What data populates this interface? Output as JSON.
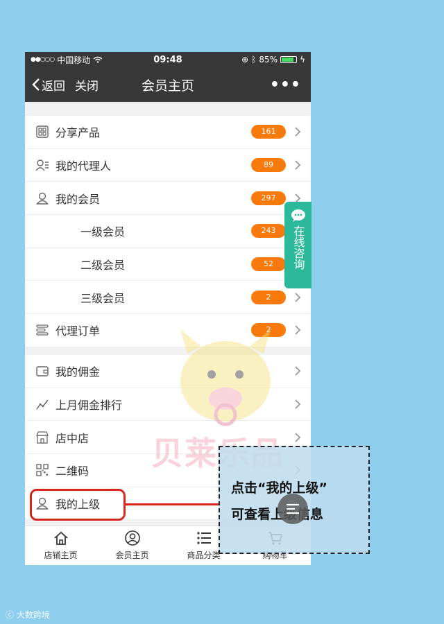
{
  "status_bar": {
    "carrier": "中国移动",
    "time": "09:48",
    "battery": "85%",
    "battery_level": 0.85
  },
  "nav": {
    "back_label": "返回",
    "close_label": "关闭",
    "title": "会员主页",
    "more_label": "•••"
  },
  "menu_group1": [
    {
      "icon": "grid-icon",
      "label": "分享产品",
      "count": "161",
      "sub": false
    },
    {
      "icon": "agent-icon",
      "label": "我的代理人",
      "count": "89",
      "sub": false
    },
    {
      "icon": "user-icon",
      "label": "我的会员",
      "count": "297",
      "sub": false
    },
    {
      "icon": "",
      "label": "一级会员",
      "count": "243",
      "sub": true
    },
    {
      "icon": "",
      "label": "二级会员",
      "count": "52",
      "sub": true
    },
    {
      "icon": "",
      "label": "三级会员",
      "count": "2",
      "sub": true
    },
    {
      "icon": "list-icon",
      "label": "代理订单",
      "count": "2",
      "sub": false
    }
  ],
  "menu_group2": [
    {
      "icon": "wallet-icon",
      "label": "我的佣金"
    },
    {
      "icon": "trend-icon",
      "label": "上月佣金排行"
    },
    {
      "icon": "store-icon",
      "label": "店中店"
    },
    {
      "icon": "qrcode-icon",
      "label": "二维码"
    },
    {
      "icon": "user-icon",
      "label": "我的上级"
    }
  ],
  "consult": {
    "label": "在线咨询"
  },
  "tabbar": [
    {
      "icon": "home-icon",
      "label": "店铺主页"
    },
    {
      "icon": "member-icon",
      "label": "会员主页"
    },
    {
      "icon": "category-icon",
      "label": "商品分类"
    },
    {
      "icon": "cart-icon",
      "label": "购物车"
    }
  ],
  "callout": {
    "line1": "点击“我的上级”",
    "line2": "可查看上级信息"
  },
  "watermark": {
    "site": "大数跨境",
    "brand": "贝莱乐品"
  },
  "colors": {
    "badge": "#f97a0c",
    "nav_bg": "#383838",
    "consult": "#2bb89b",
    "highlight": "#d9261c",
    "page_bg": "#8ecfef"
  }
}
